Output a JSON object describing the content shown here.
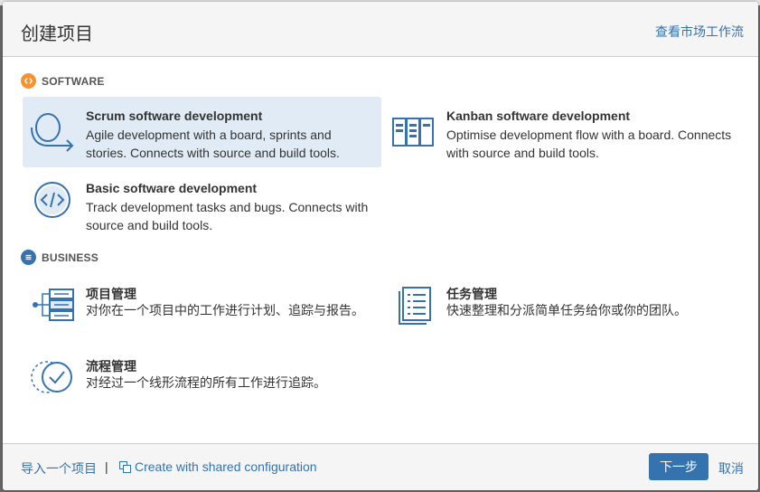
{
  "dialog": {
    "title": "创建项目",
    "market_link": "查看市场工作流"
  },
  "sections": {
    "software": {
      "label": "SOFTWARE",
      "color": "#f79232"
    },
    "business": {
      "label": "BUSINESS",
      "color": "#3572b0"
    }
  },
  "tiles": {
    "scrum": {
      "title": "Scrum software development",
      "desc": "Agile development with a board, sprints and stories. Connects with source and build tools.",
      "icon": "scrum-cycle-icon"
    },
    "kanban": {
      "title": "Kanban software development",
      "desc": "Optimise development flow with a board. Connects with source and build tools.",
      "icon": "kanban-board-icon"
    },
    "basic": {
      "title": "Basic software development",
      "desc": "Track development tasks and bugs. Connects with source and build tools.",
      "icon": "code-icon"
    },
    "project_mgmt": {
      "title": "项目管理",
      "desc": "对你在一个项目中的工作进行计划、追踪与报告。",
      "icon": "project-management-icon"
    },
    "task_mgmt": {
      "title": "任务管理",
      "desc": "快速整理和分派简单任务给你或你的团队。",
      "icon": "task-list-icon"
    },
    "process_mgmt": {
      "title": "流程管理",
      "desc": "对经过一个线形流程的所有工作进行追踪。",
      "icon": "process-check-icon"
    }
  },
  "footer": {
    "import_link": "导入一个项目",
    "separator": "|",
    "shared_link": "Create with shared configuration",
    "next_button": "下一步",
    "cancel_link": "取消"
  },
  "colors": {
    "accent": "#3572b0",
    "selected_tile": "#e0ebf5",
    "software_badge": "#f79232"
  }
}
